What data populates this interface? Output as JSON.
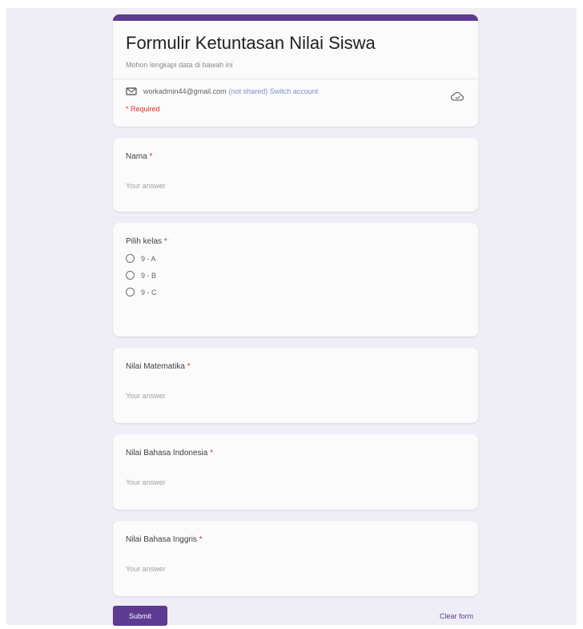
{
  "form": {
    "title": "Formulir Ketuntasan Nilai Siswa",
    "description": "Mohon lengkapi data di bawah ini",
    "account_email": "workadmin44@gmail.com",
    "switch_account": "(not shared) Switch account",
    "required_note": "* Required",
    "accent_color": "#5c3b91"
  },
  "questions": [
    {
      "label": "Nama",
      "required": "*",
      "type": "text",
      "placeholder": "Your answer"
    },
    {
      "label": "Pilih kelas",
      "required": "*",
      "type": "radio",
      "options": [
        "9 - A",
        "9 - B",
        "9 - C"
      ]
    },
    {
      "label": "Nilai Matematika",
      "required": "*",
      "type": "text",
      "placeholder": "Your answer"
    },
    {
      "label": "Nilai Bahasa Indonesia",
      "required": "*",
      "type": "text",
      "placeholder": "Your answer"
    },
    {
      "label": "Nilai Bahasa Inggris",
      "required": "*",
      "type": "text",
      "placeholder": "Your answer"
    }
  ],
  "footer": {
    "submit_label": "Submit",
    "clear_label": "Clear form"
  }
}
